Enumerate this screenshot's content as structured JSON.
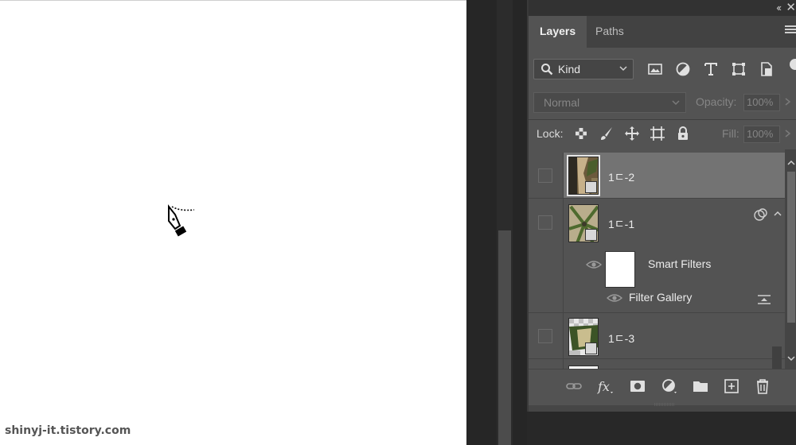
{
  "panel": {
    "tabs": [
      {
        "label": "Layers",
        "active": true
      },
      {
        "label": "Paths",
        "active": false
      }
    ]
  },
  "filter": {
    "kind_label": "Kind",
    "icons": [
      "pixel-layer-filter-icon",
      "adjustment-layer-filter-icon",
      "type-layer-filter-icon",
      "shape-layer-filter-icon",
      "smart-object-filter-icon"
    ]
  },
  "blend": {
    "mode": "Normal",
    "opacity_label": "Opacity:",
    "opacity_value": "100%"
  },
  "lock": {
    "label": "Lock:",
    "fill_label": "Fill:",
    "fill_value": "100%",
    "icons": [
      "lock-transparent-pixels-icon",
      "lock-image-pixels-icon",
      "lock-position-icon",
      "lock-artboard-icon",
      "lock-all-icon"
    ]
  },
  "layers": [
    {
      "name": "1ㄷ-2",
      "selected": true
    },
    {
      "name": "1ㄷ-1",
      "selected": false
    },
    {
      "name": "1ㄷ-3",
      "selected": false
    }
  ],
  "smart_filters": {
    "label": "Smart Filters",
    "filter_name": "Filter Gallery"
  },
  "bottom_icons": [
    "link-layers-icon",
    "add-layer-style-icon",
    "add-mask-icon",
    "new-fill-adjustment-icon",
    "new-group-icon",
    "new-layer-icon",
    "delete-layer-icon"
  ],
  "watermark": "shinyj-it.tistory.com",
  "colors": {
    "panel_bg": "#535353",
    "selected_row": "#737373",
    "tab_bar": "#424242",
    "canvas": "#ffffff"
  }
}
